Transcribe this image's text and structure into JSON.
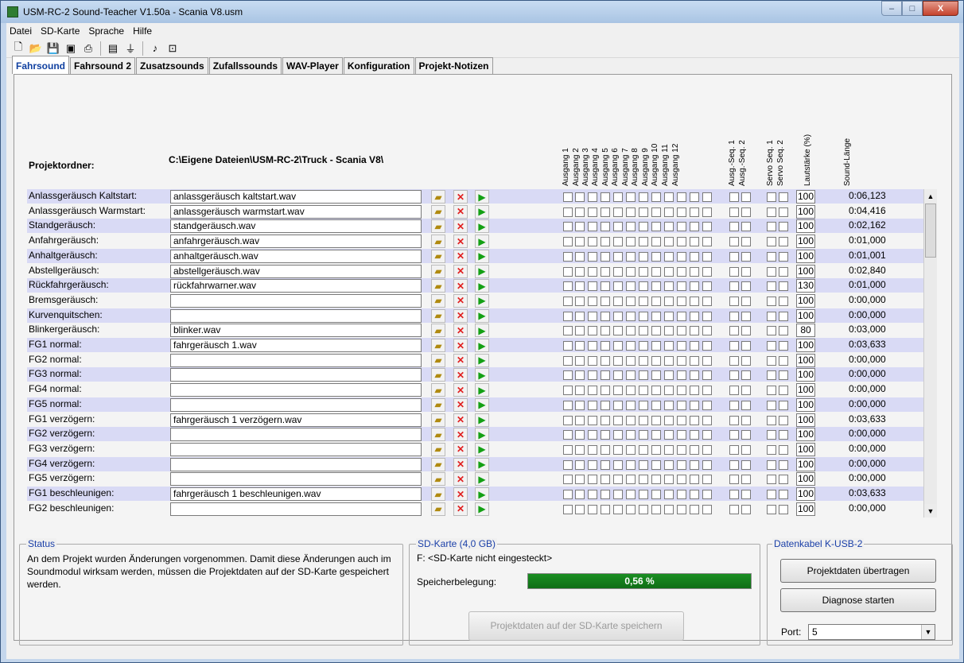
{
  "window": {
    "title": "USM-RC-2 Sound-Teacher V1.50a - Scania V8.usm",
    "min": "–",
    "max": "□",
    "close": "X"
  },
  "menu": [
    "Datei",
    "SD-Karte",
    "Sprache",
    "Hilfe"
  ],
  "toolbar": [
    {
      "name": "new-icon",
      "glyph": "🗋"
    },
    {
      "name": "open-icon",
      "glyph": "📂"
    },
    {
      "name": "save-icon",
      "glyph": "💾"
    },
    {
      "name": "save-red-icon",
      "glyph": "▣"
    },
    {
      "name": "print-icon",
      "glyph": "⎙"
    },
    {
      "name": "sd-icon",
      "glyph": "▤"
    },
    {
      "name": "usb-icon",
      "glyph": "⏚"
    },
    {
      "name": "note-icon",
      "glyph": "♪"
    },
    {
      "name": "pdf-icon",
      "glyph": "⊡"
    }
  ],
  "tabs": [
    "Fahrsound",
    "Fahrsound 2",
    "Zusatzsounds",
    "Zufallssounds",
    "WAV-Player",
    "Konfiguration",
    "Projekt-Notizen"
  ],
  "active_tab": "Fahrsound",
  "project": {
    "label": "Projektordner:",
    "path": "C:\\Eigene Dateien\\USM-RC-2\\Truck - Scania V8\\"
  },
  "headers": {
    "outputs": [
      "Ausgang 1",
      "Ausgang 2",
      "Ausgang 3",
      "Ausgang 4",
      "Ausgang 5",
      "Ausgang 6",
      "Ausgang 7",
      "Ausgang 8",
      "Ausgang 9",
      "Ausgang 10",
      "Ausgang 11",
      "Ausgang 12"
    ],
    "seq": [
      "Ausg.-Seq. 1",
      "Ausg.-Seq. 2"
    ],
    "servo": [
      "Servo Seq. 1",
      "Servo Seq. 2"
    ],
    "volume": "Lautstärke (%)",
    "length": "Sound-Länge"
  },
  "rows": [
    {
      "label": "Anlassgeräusch Kaltstart:",
      "file": "anlassgeräusch kaltstart.wav",
      "vol": "100",
      "len": "0:06,123"
    },
    {
      "label": "Anlassgeräusch Warmstart:",
      "file": "anlassgeräusch warmstart.wav",
      "vol": "100",
      "len": "0:04,416"
    },
    {
      "label": "Standgeräusch:",
      "file": "standgeräusch.wav",
      "vol": "100",
      "len": "0:02,162"
    },
    {
      "label": "Anfahrgeräusch:",
      "file": "anfahrgeräusch.wav",
      "vol": "100",
      "len": "0:01,000"
    },
    {
      "label": "Anhaltgeräusch:",
      "file": "anhaltgeräusch.wav",
      "vol": "100",
      "len": "0:01,001"
    },
    {
      "label": "Abstellgeräusch:",
      "file": "abstellgeräusch.wav",
      "vol": "100",
      "len": "0:02,840"
    },
    {
      "label": "Rückfahrgeräusch:",
      "file": "rückfahrwarner.wav",
      "vol": "130",
      "len": "0:01,000"
    },
    {
      "label": "Bremsgeräusch:",
      "file": "",
      "vol": "100",
      "len": "0:00,000"
    },
    {
      "label": "Kurvenquitschen:",
      "file": "",
      "vol": "100",
      "len": "0:00,000"
    },
    {
      "label": "Blinkergeräusch:",
      "file": "blinker.wav",
      "vol": "80",
      "len": "0:03,000"
    },
    {
      "label": "FG1 normal:",
      "file": "fahrgeräusch 1.wav",
      "vol": "100",
      "len": "0:03,633"
    },
    {
      "label": "FG2 normal:",
      "file": "",
      "vol": "100",
      "len": "0:00,000"
    },
    {
      "label": "FG3 normal:",
      "file": "",
      "vol": "100",
      "len": "0:00,000"
    },
    {
      "label": "FG4 normal:",
      "file": "",
      "vol": "100",
      "len": "0:00,000"
    },
    {
      "label": "FG5 normal:",
      "file": "",
      "vol": "100",
      "len": "0:00,000"
    },
    {
      "label": "FG1 verzögern:",
      "file": "fahrgeräusch 1 verzögern.wav",
      "vol": "100",
      "len": "0:03,633"
    },
    {
      "label": "FG2 verzögern:",
      "file": "",
      "vol": "100",
      "len": "0:00,000"
    },
    {
      "label": "FG3 verzögern:",
      "file": "",
      "vol": "100",
      "len": "0:00,000"
    },
    {
      "label": "FG4 verzögern:",
      "file": "",
      "vol": "100",
      "len": "0:00,000"
    },
    {
      "label": "FG5 verzögern:",
      "file": "",
      "vol": "100",
      "len": "0:00,000"
    },
    {
      "label": "FG1 beschleunigen:",
      "file": "fahrgeräusch 1 beschleunigen.wav",
      "vol": "100",
      "len": "0:03,633"
    },
    {
      "label": "FG2 beschleunigen:",
      "file": "",
      "vol": "100",
      "len": "0:00,000"
    }
  ],
  "status": {
    "legend": "Status",
    "text": "An dem Projekt wurden Änderungen vorgenommen. Damit diese Änderungen auch im Soundmodul wirksam werden, müssen die Projektdaten auf der SD-Karte gespeichert werden."
  },
  "sd": {
    "legend": "SD-Karte (4,0 GB)",
    "drive": "F: <SD-Karte nicht eingesteckt>",
    "usage_label": "Speicherbelegung:",
    "usage_text": "0,56 %",
    "usage_fraction": 0.0056,
    "save_button": "Projektdaten auf der SD-Karte speichern"
  },
  "cable": {
    "legend": "Datenkabel K-USB-2",
    "transfer_button": "Projektdaten übertragen",
    "diag_button": "Diagnose starten",
    "port_label": "Port:",
    "port_value": "5"
  },
  "colors": {
    "row_odd": "#d9daf5",
    "progress": "#138a1c",
    "legend": "#1a3fa8"
  }
}
